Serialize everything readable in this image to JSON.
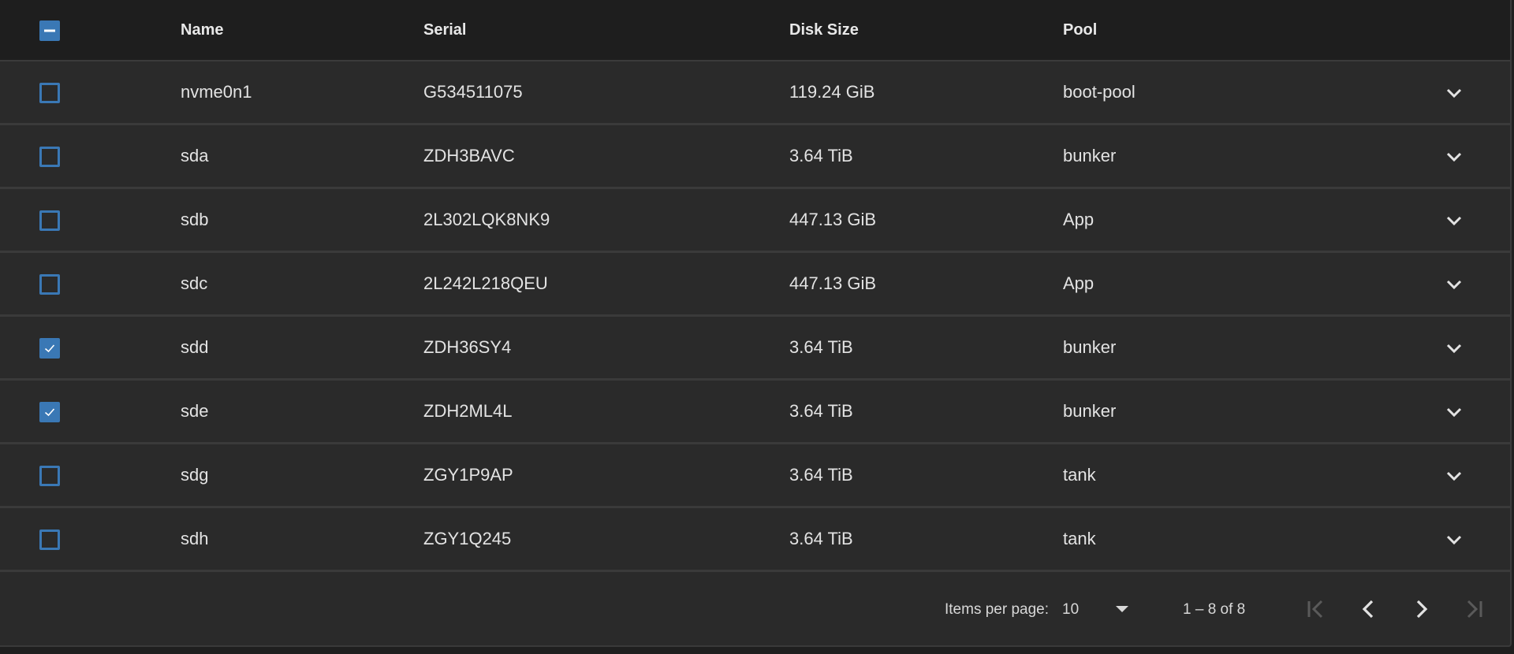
{
  "table": {
    "columns": {
      "name": "Name",
      "serial": "Serial",
      "disk_size": "Disk Size",
      "pool": "Pool"
    },
    "rows": [
      {
        "name": "nvme0n1",
        "serial": "G534511075",
        "disk_size": "119.24 GiB",
        "pool": "boot-pool",
        "checked": false
      },
      {
        "name": "sda",
        "serial": "ZDH3BAVC",
        "disk_size": "3.64 TiB",
        "pool": "bunker",
        "checked": false
      },
      {
        "name": "sdb",
        "serial": "2L302LQK8NK9",
        "disk_size": "447.13 GiB",
        "pool": "App",
        "checked": false
      },
      {
        "name": "sdc",
        "serial": "2L242L218QEU",
        "disk_size": "447.13 GiB",
        "pool": "App",
        "checked": false
      },
      {
        "name": "sdd",
        "serial": "ZDH36SY4",
        "disk_size": "3.64 TiB",
        "pool": "bunker",
        "checked": true
      },
      {
        "name": "sde",
        "serial": "ZDH2ML4L",
        "disk_size": "3.64 TiB",
        "pool": "bunker",
        "checked": true
      },
      {
        "name": "sdg",
        "serial": "ZGY1P9AP",
        "disk_size": "3.64 TiB",
        "pool": "tank",
        "checked": false
      },
      {
        "name": "sdh",
        "serial": "ZGY1Q245",
        "disk_size": "3.64 TiB",
        "pool": "tank",
        "checked": false
      }
    ]
  },
  "paginator": {
    "items_per_page_label": "Items per page:",
    "items_per_page_value": "10",
    "range_label": "1 – 8 of 8"
  },
  "colors": {
    "accent": "#3a78b5",
    "background": "#2a2a2a",
    "header_background": "#1e1e1e",
    "disabled_icon": "#5a5a5a"
  },
  "icons": {
    "header_checkbox": "indeterminate-checkbox-icon",
    "row_expand": "chevron-down-icon",
    "first_page": "first-page-icon",
    "prev_page": "chevron-left-icon",
    "next_page": "chevron-right-icon",
    "last_page": "last-page-icon"
  }
}
